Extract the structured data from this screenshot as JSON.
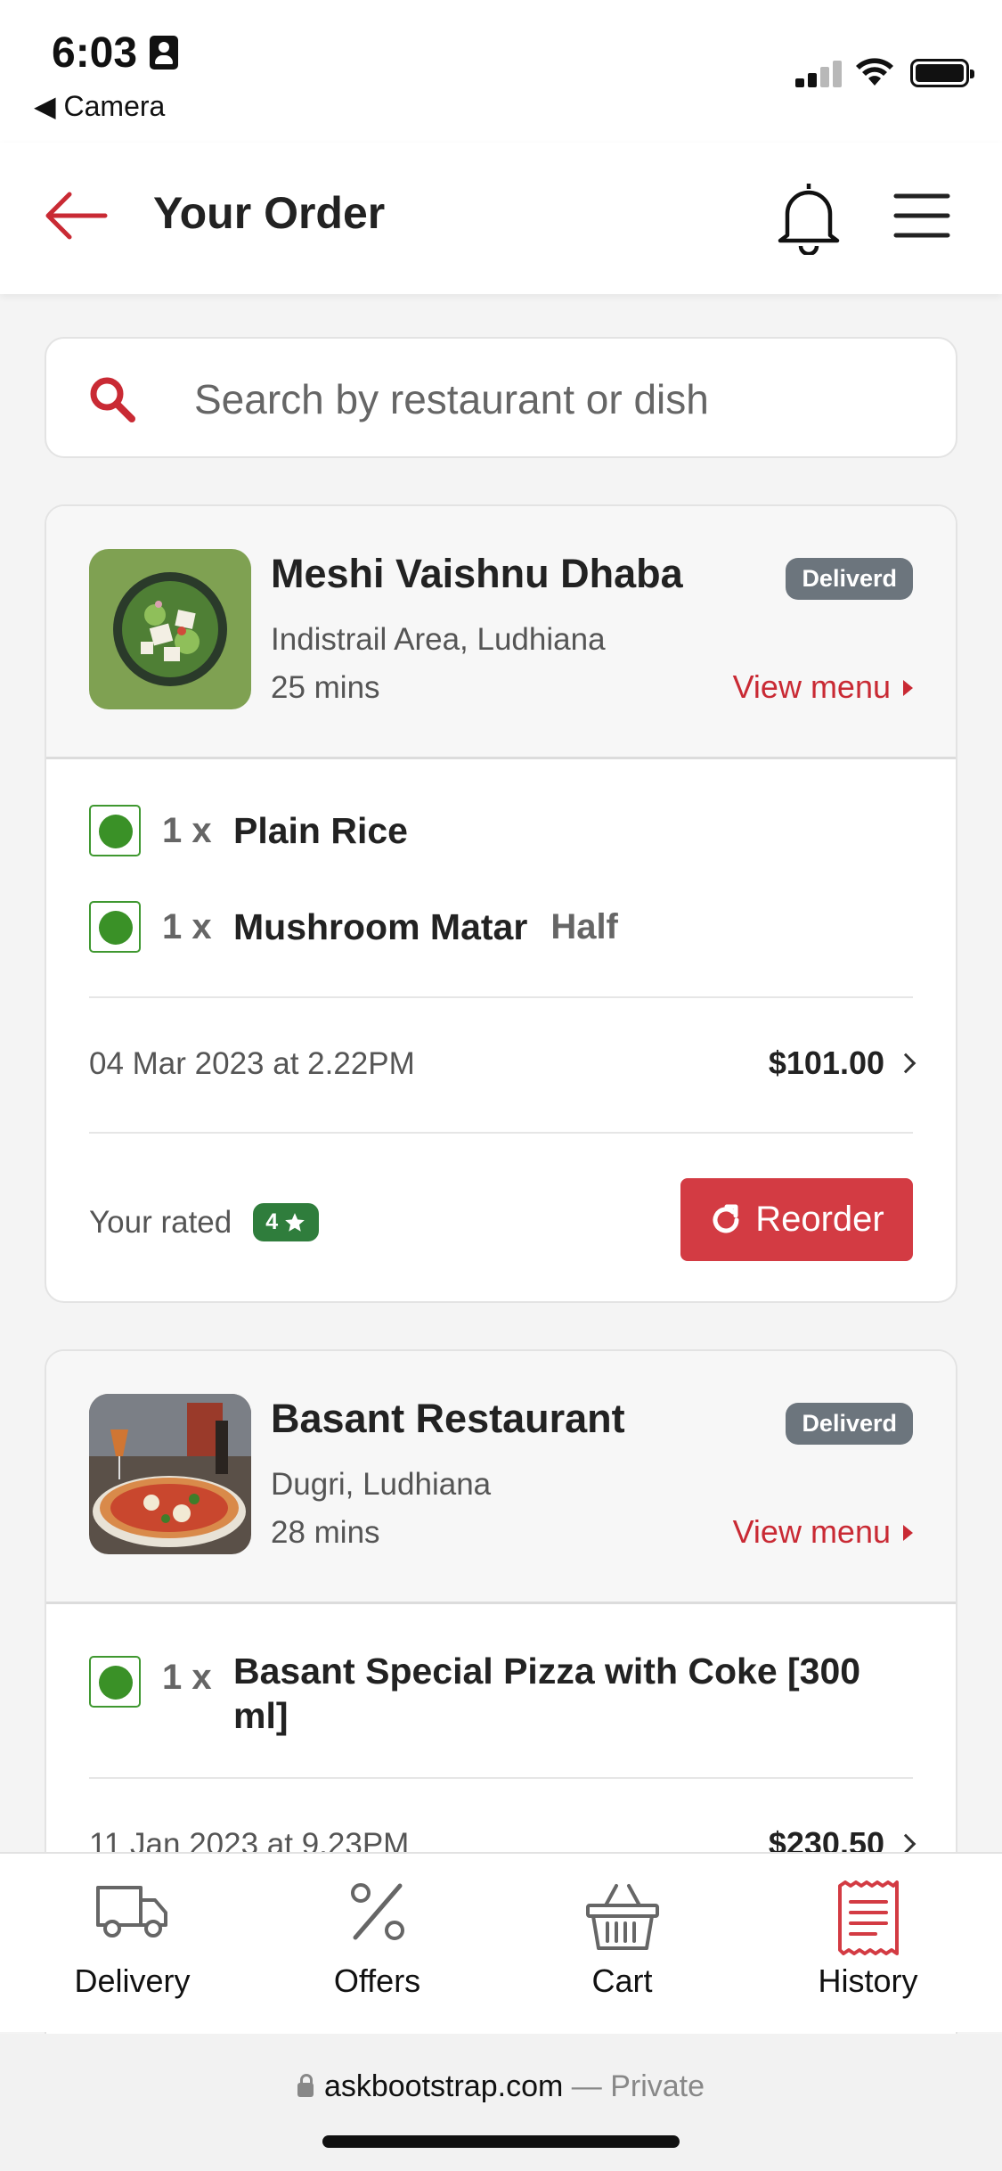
{
  "status_bar": {
    "time": "6:03",
    "back_app": "◀ Camera"
  },
  "header": {
    "title": "Your Order"
  },
  "search": {
    "placeholder": "Search by restaurant or dish"
  },
  "orders": [
    {
      "restaurant": "Meshi Vaishnu Dhaba",
      "location": "Indistrail Area, Ludhiana",
      "eta": "25 mins",
      "status": "Deliverd",
      "view_menu": "View menu",
      "items": [
        {
          "qty": "1 x",
          "name": "Plain Rice",
          "variant": ""
        },
        {
          "qty": "1 x",
          "name": "Mushroom Matar",
          "variant": "Half"
        }
      ],
      "date": "04 Mar 2023 at 2.22PM",
      "total": "$101.00",
      "rated_label": "Your rated",
      "rating": "4",
      "reorder": "Reorder"
    },
    {
      "restaurant": "Basant Restaurant",
      "location": "Dugri, Ludhiana",
      "eta": "28 mins",
      "status": "Deliverd",
      "view_menu": "View menu",
      "items": [
        {
          "qty": "1 x",
          "name": "Basant Special Pizza with Coke [300 ml]",
          "variant": ""
        }
      ],
      "date": "11 Jan 2023 at 9.23PM",
      "total": "$230.50"
    }
  ],
  "bottom_nav": [
    {
      "label": "Delivery",
      "icon": "truck-icon"
    },
    {
      "label": "Offers",
      "icon": "percent-icon"
    },
    {
      "label": "Cart",
      "icon": "basket-icon"
    },
    {
      "label": "History",
      "icon": "receipt-icon",
      "active": true
    }
  ],
  "browser": {
    "domain": "askbootstrap.com",
    "private_label": "— Private"
  },
  "colors": {
    "accent": "#c92a34",
    "badge": "#6c757d",
    "rating": "#2f7d3c",
    "veg": "#3a9127"
  }
}
